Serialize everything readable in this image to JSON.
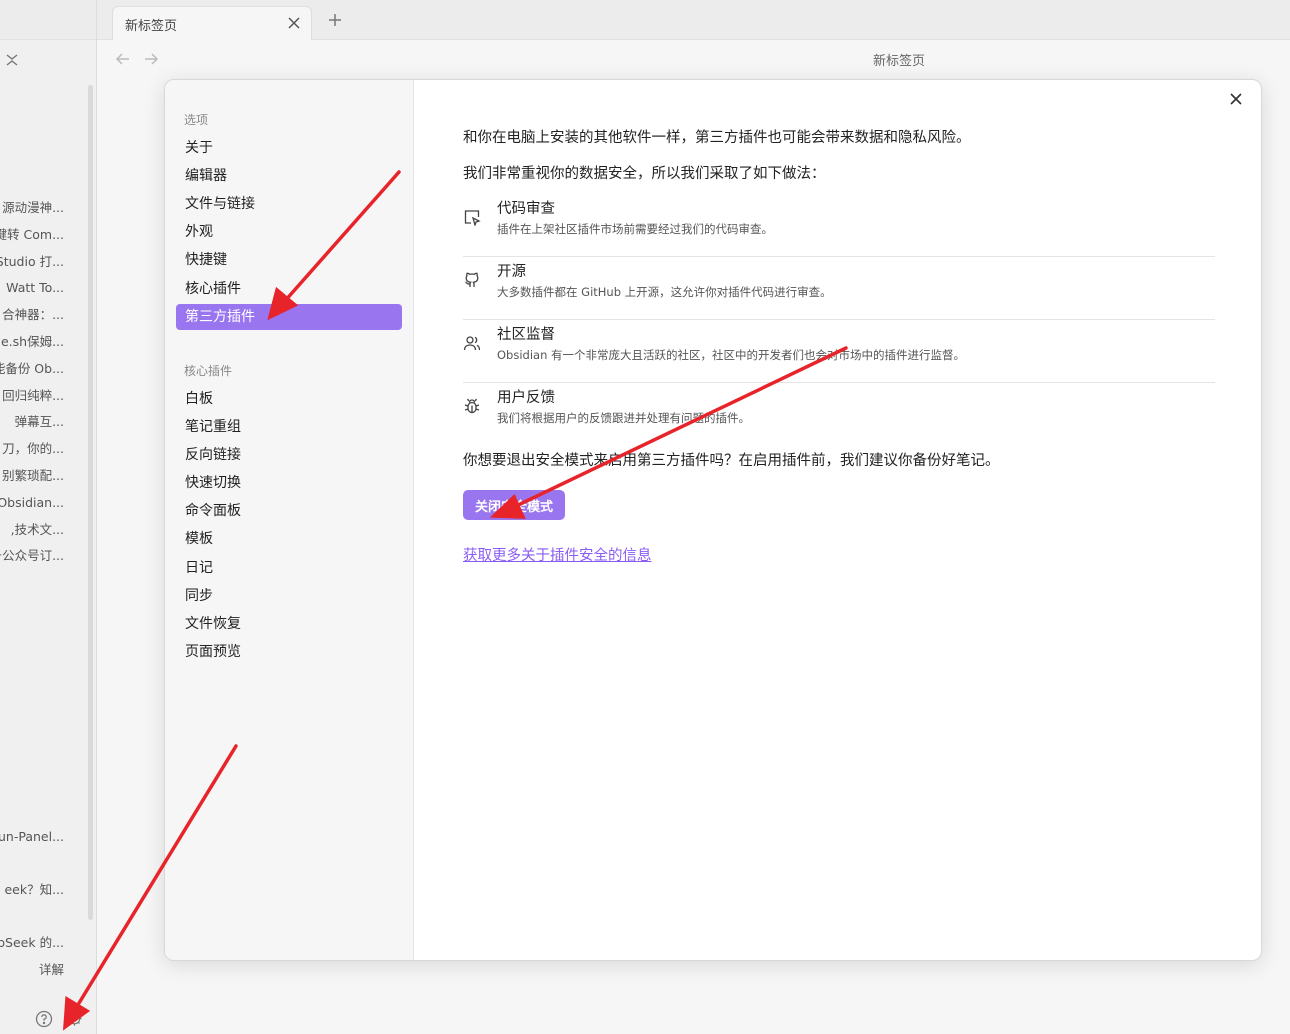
{
  "left_sidebar": {
    "files": [
      "源动漫神...",
      "键转 Com...",
      "Studio 打...",
      "Watt To...",
      "合神器：...",
      "ne.sh保姆...",
      "能备份 Ob...",
      "回归纯粹...",
      "弹幕互...",
      "刀，你的...",
      "别繁琐配...",
      "Obsidian...",
      ",技术文...",
      "号公众号订...",
      "un-Panel...",
      "eek？知...",
      "pSeek 的...",
      "详解"
    ]
  },
  "tab": {
    "title": "新标签页"
  },
  "view": {
    "title": "新标签页"
  },
  "settings": {
    "group_options_title": "选项",
    "options": [
      "关于",
      "编辑器",
      "文件与链接",
      "外观",
      "快捷键",
      "核心插件",
      "第三方插件"
    ],
    "group_core_title": "核心插件",
    "core_plugins": [
      "白板",
      "笔记重组",
      "反向链接",
      "快速切换",
      "命令面板",
      "模板",
      "日记",
      "同步",
      "文件恢复",
      "页面预览"
    ]
  },
  "content": {
    "intro": "和你在电脑上安装的其他软件一样，第三方插件也可能会带来数据和隐私风险。",
    "measures_intro": "我们非常重视你的数据安全，所以我们采取了如下做法：",
    "features": [
      {
        "icon": "code-review-icon",
        "title": "代码审查",
        "desc": "插件在上架社区插件市场前需要经过我们的代码审查。"
      },
      {
        "icon": "github-icon",
        "title": "开源",
        "desc": "大多数插件都在 GitHub 上开源，这允许你对插件代码进行审查。"
      },
      {
        "icon": "users-icon",
        "title": "社区监督",
        "desc": "Obsidian 有一个非常庞大且活跃的社区，社区中的开发者们也会对市场中的插件进行监督。"
      },
      {
        "icon": "bug-icon",
        "title": "用户反馈",
        "desc": "我们将根据用户的反馈跟进并处理有问题的插件。"
      }
    ],
    "question": "你想要退出安全模式来启用第三方插件吗？在启用插件前，我们建议你备份好笔记。",
    "button_label": "关闭安全模式",
    "link_text": "获取更多关于插件安全的信息"
  },
  "colors": {
    "accent": "#9a75f0",
    "link": "#8a5cf5",
    "annotation": "#e8242b"
  }
}
